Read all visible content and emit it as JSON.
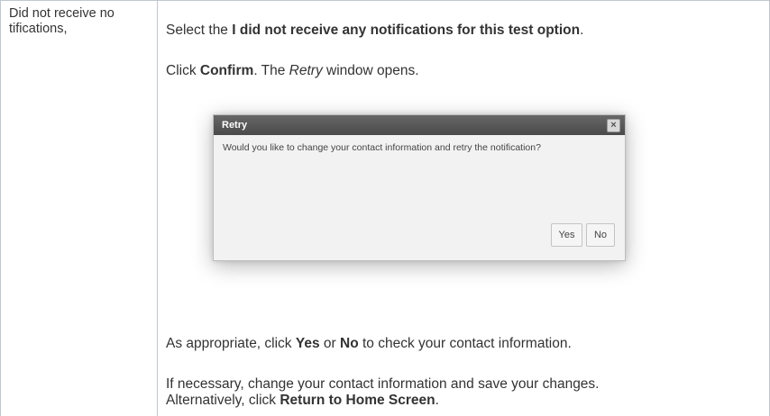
{
  "row": {
    "label": "Did not receive notifications,"
  },
  "steps": {
    "select_prefix": "Select the ",
    "select_option": "I did not receive any notifications for this test option",
    "select_suffix": ".",
    "click_prefix": "Click ",
    "confirm_label": "Confirm",
    "click_middle": ". The ",
    "window_name": "Retry",
    "click_suffix": " window opens.",
    "appropriate_prefix": "As appropriate, click ",
    "yes_label": "Yes",
    "or_text": " or ",
    "no_label": "No",
    "appropriate_suffix": " to check your contact information.",
    "necessary_text": "If necessary, change your contact information and save your changes.",
    "alternatively_prefix": "Alternatively, click ",
    "return_label": "Return to Home Screen",
    "alternatively_suffix": "."
  },
  "dialog": {
    "title": "Retry",
    "close_glyph": "×",
    "message": "Would you like to change your contact information and retry the notification?",
    "yes_button": "Yes",
    "no_button": "No"
  }
}
